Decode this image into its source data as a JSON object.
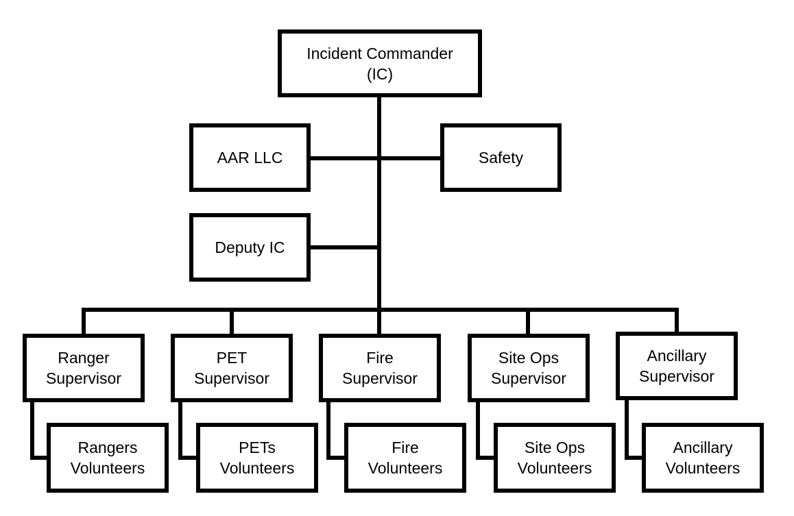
{
  "diagram": {
    "type": "org-chart",
    "line_color": "#000000",
    "box_border_color": "#000000",
    "background": "#ffffff",
    "nodes": {
      "ic": {
        "lines": [
          "Incident Commander",
          "(IC)"
        ]
      },
      "aar": {
        "lines": [
          "AAR LLC"
        ]
      },
      "safety": {
        "lines": [
          "Safety"
        ]
      },
      "deputy": {
        "lines": [
          "Deputy IC"
        ]
      },
      "ranger_sup": {
        "lines": [
          "Ranger",
          "Supervisor"
        ]
      },
      "pet_sup": {
        "lines": [
          "PET",
          "Supervisor"
        ]
      },
      "fire_sup": {
        "lines": [
          "Fire",
          "Supervisor"
        ]
      },
      "siteops_sup": {
        "lines": [
          "Site Ops",
          "Supervisor"
        ]
      },
      "anc_sup": {
        "lines": [
          "Ancillary",
          "Supervisor"
        ]
      },
      "ranger_vol": {
        "lines": [
          "Rangers",
          "Volunteers"
        ]
      },
      "pet_vol": {
        "lines": [
          "PETs",
          "Volunteers"
        ]
      },
      "fire_vol": {
        "lines": [
          "Fire",
          "Volunteers"
        ]
      },
      "siteops_vol": {
        "lines": [
          "Site Ops",
          "Volunteers"
        ]
      },
      "anc_vol": {
        "lines": [
          "Ancillary",
          "Volunteers"
        ]
      }
    },
    "edges": [
      [
        "ic",
        "aar"
      ],
      [
        "ic",
        "safety"
      ],
      [
        "ic",
        "deputy"
      ],
      [
        "ic",
        "ranger_sup"
      ],
      [
        "ic",
        "pet_sup"
      ],
      [
        "ic",
        "fire_sup"
      ],
      [
        "ic",
        "siteops_sup"
      ],
      [
        "ic",
        "anc_sup"
      ],
      [
        "ranger_sup",
        "ranger_vol"
      ],
      [
        "pet_sup",
        "pet_vol"
      ],
      [
        "fire_sup",
        "fire_vol"
      ],
      [
        "siteops_sup",
        "siteops_vol"
      ],
      [
        "anc_sup",
        "anc_vol"
      ]
    ]
  }
}
